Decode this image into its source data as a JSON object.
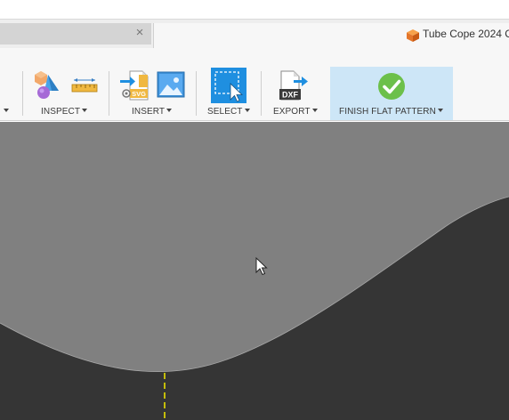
{
  "tabs": {
    "inactive_close": "×",
    "active_title": "Tube Cope 2024 C"
  },
  "toolbar": {
    "inspect_label": "INSPECT",
    "insert_label": "INSERT",
    "select_label": "SELECT",
    "export_label": "EXPORT",
    "finish_label": "FINISH FLAT PATTERN",
    "dxf_text": "DXF",
    "svg_text": "SVG"
  },
  "icons": {
    "cube": "orange-cube-icon",
    "inspect_shapes": "inspect-shapes-icon",
    "measure": "measure-ruler-icon",
    "insert_svg": "insert-svg-icon",
    "insert_image": "insert-image-icon",
    "select": "select-cursor-icon",
    "export_dxf": "export-dxf-icon",
    "finish": "green-check-icon"
  },
  "colors": {
    "finish_highlight": "#cde6f7",
    "select_blue": "#1f8fe0",
    "check_green": "#6cc04a",
    "viewport_top": "#808080",
    "viewport_bottom": "#353535",
    "center_line": "#e8e000"
  }
}
